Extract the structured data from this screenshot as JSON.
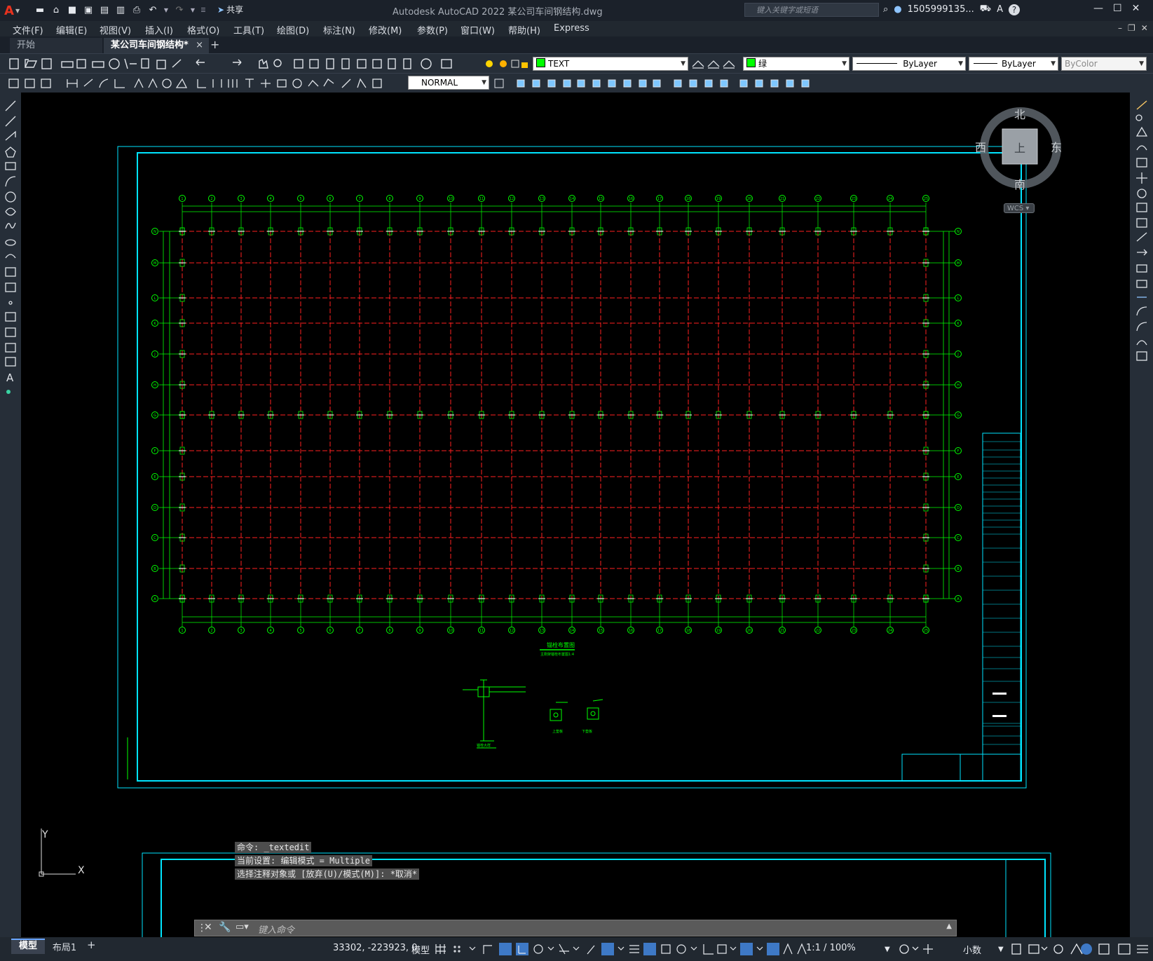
{
  "app": {
    "logo_letter": "A",
    "title": "Autodesk AutoCAD 2022    某公司车间钢结构.dwg",
    "share_label": "共享",
    "search_placeholder": "键入关键字或短语",
    "user_name": "1505999135..."
  },
  "menu": [
    "文件(F)",
    "编辑(E)",
    "视图(V)",
    "插入(I)",
    "格式(O)",
    "工具(T)",
    "绘图(D)",
    "标注(N)",
    "修改(M)",
    "参数(P)",
    "窗口(W)",
    "帮助(H)",
    "Express"
  ],
  "tabs": {
    "start": "开始",
    "doc": "某公司车间钢结构*",
    "close": "×",
    "add": "+"
  },
  "toolbar": {
    "layer_name": "TEXT",
    "layer_color": "#00ff00",
    "color_name": "绿",
    "linetype": "ByLayer",
    "lineweight": "ByLayer",
    "plotstyle": "ByColor",
    "dimstyle": "NORMAL"
  },
  "viewcube": {
    "north": "北",
    "south": "南",
    "east": "东",
    "west": "西",
    "top": "上",
    "wcs": "WCS"
  },
  "ucs": {
    "x": "X",
    "y": "Y"
  },
  "drawing": {
    "plan_title": "锚栓布置图",
    "plan_subtitle": "主刚架锚栓布置图1:4",
    "column_labels": [
      "1",
      "2",
      "3",
      "4",
      "5",
      "6",
      "7",
      "8",
      "9",
      "10",
      "11",
      "12",
      "13",
      "14",
      "15",
      "16",
      "17",
      "18",
      "19",
      "20",
      "21",
      "22",
      "23",
      "24",
      "25"
    ],
    "row_labels": [
      "N",
      "M",
      "L",
      "K",
      "J",
      "H",
      "G",
      "F",
      "E",
      "D",
      "C",
      "B",
      "A"
    ],
    "detail_labels": [
      "锚栓大样",
      "上垫板",
      "下垫板"
    ]
  },
  "command": {
    "history": [
      "命令: _textedit",
      "当前设置: 编辑模式 = Multiple",
      "选择注释对象或 [放弃(U)/模式(M)]: *取消*"
    ],
    "placeholder": "键入命令"
  },
  "status": {
    "layout_tabs": [
      "模型",
      "布局1"
    ],
    "add_tab": "+",
    "coords": "33302, -223923, 0",
    "model_label": "模型",
    "scale": "1:1 / 100%",
    "units": "小数"
  }
}
